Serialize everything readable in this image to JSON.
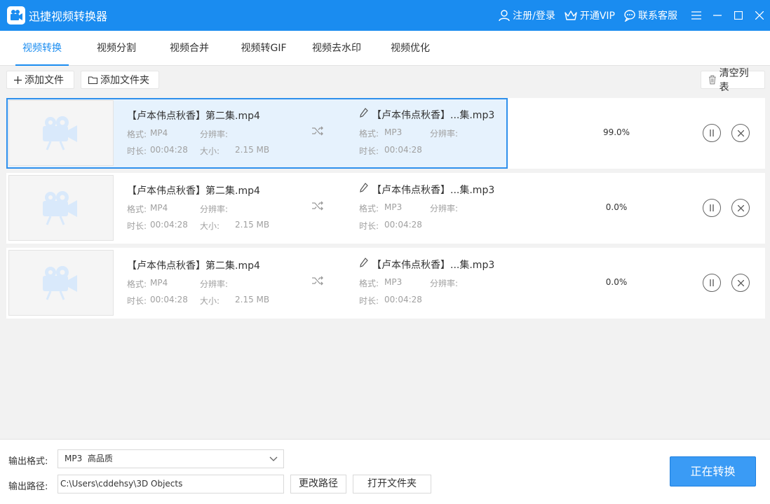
{
  "app": {
    "title": "迅捷视频转换器"
  },
  "titlebar": {
    "login": "注册/登录",
    "vip": "开通VIP",
    "support": "联系客服"
  },
  "tabs": [
    {
      "label": "视频转换",
      "active": true
    },
    {
      "label": "视频分割",
      "active": false
    },
    {
      "label": "视频合并",
      "active": false
    },
    {
      "label": "视频转GIF",
      "active": false
    },
    {
      "label": "视频去水印",
      "active": false
    },
    {
      "label": "视频优化",
      "active": false
    }
  ],
  "toolbar": {
    "add_file": "添加文件",
    "add_folder": "添加文件夹",
    "clear_list": "清空列表"
  },
  "files": [
    {
      "source": {
        "name": "【卢本伟点秋香】第二集.mp4",
        "format_label": "格式:",
        "format": "MP4",
        "resolution_label": "分辨率:",
        "resolution": "",
        "duration_label": "时长:",
        "duration": "00:04:28",
        "size_label": "大小:",
        "size": "2.15 MB"
      },
      "output": {
        "name": "【卢本伟点秋香】...集.mp3",
        "format_label": "格式:",
        "format": "MP3",
        "resolution_label": "分辨率:",
        "resolution": "",
        "duration_label": "时长:",
        "duration": "00:04:28"
      },
      "progress": "99.0%",
      "progress_fraction": 0.99
    },
    {
      "source": {
        "name": "【卢本伟点秋香】第二集.mp4",
        "format_label": "格式:",
        "format": "MP4",
        "resolution_label": "分辨率:",
        "resolution": "",
        "duration_label": "时长:",
        "duration": "00:04:28",
        "size_label": "大小:",
        "size": "2.15 MB"
      },
      "output": {
        "name": "【卢本伟点秋香】...集.mp3",
        "format_label": "格式:",
        "format": "MP3",
        "resolution_label": "分辨率:",
        "resolution": "",
        "duration_label": "时长:",
        "duration": "00:04:28"
      },
      "progress": "0.0%",
      "progress_fraction": 0
    },
    {
      "source": {
        "name": "【卢本伟点秋香】第二集.mp4",
        "format_label": "格式:",
        "format": "MP4",
        "resolution_label": "分辨率:",
        "resolution": "",
        "duration_label": "时长:",
        "duration": "00:04:28",
        "size_label": "大小:",
        "size": "2.15 MB"
      },
      "output": {
        "name": "【卢本伟点秋香】...集.mp3",
        "format_label": "格式:",
        "format": "MP3",
        "resolution_label": "分辨率:",
        "resolution": "",
        "duration_label": "时长:",
        "duration": "00:04:28"
      },
      "progress": "0.0%",
      "progress_fraction": 0
    }
  ],
  "footer": {
    "format_label": "输出格式:",
    "format_value": "MP3  高品质",
    "path_label": "输出路径:",
    "path_value": "C:\\Users\\cddehsy\\3D Objects",
    "change_path": "更改路径",
    "open_folder": "打开文件夹",
    "convert": "正在转换"
  },
  "colors": {
    "accent": "#1a8cf0",
    "progress_fill": "#e6f2fd",
    "convert_button": "#3a9bf5"
  }
}
